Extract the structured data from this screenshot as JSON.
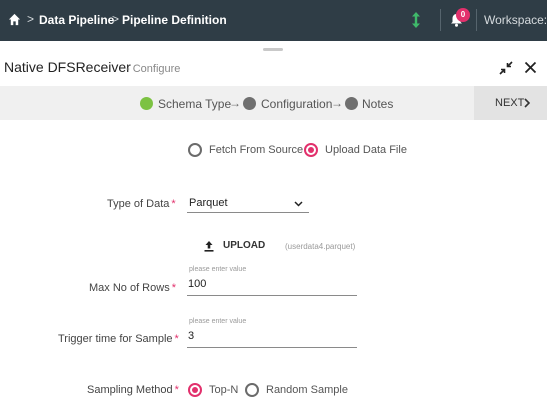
{
  "topbar": {
    "breadcrumbs": [
      "Data Pipeline",
      "Pipeline Definition"
    ],
    "separator": ">",
    "notification_count": "0",
    "workspace_label": "Workspace:"
  },
  "header": {
    "title": "Native DFSReceiver",
    "subtitle": "- Configure"
  },
  "stepper": {
    "steps": [
      {
        "label": "Schema Type",
        "state": "complete",
        "color": "#7cc242"
      },
      {
        "label": "Configuration",
        "state": "pending",
        "color": "#6f6f6f"
      },
      {
        "label": "Notes",
        "state": "pending",
        "color": "#6f6f6f"
      }
    ],
    "arrow": "→",
    "next_label": "NEXT"
  },
  "source": {
    "options": [
      "Fetch From Source",
      "Upload Data File"
    ],
    "selected": "Upload Data File"
  },
  "form": {
    "type_of_data": {
      "label": "Type of Data",
      "required_mark": "*",
      "value": "Parquet"
    },
    "upload": {
      "label": "UPLOAD",
      "file_name": "(userdata4.parquet)"
    },
    "max_rows": {
      "label": "Max No of Rows",
      "required_mark": "*",
      "placeholder": "please enter value",
      "value": "100"
    },
    "trigger_time": {
      "label": "Trigger time for Sample",
      "required_mark": "*",
      "placeholder": "please enter value",
      "value": "3"
    },
    "sampling_method": {
      "label": "Sampling Method",
      "required_mark": "*",
      "options": [
        "Top-N",
        "Random Sample"
      ],
      "selected": "Top-N"
    }
  },
  "colors": {
    "topbar": "#2f3d46",
    "accent": "#e2306c",
    "sync_icon": "#3fb96a",
    "step_complete": "#7cc242"
  },
  "icons": [
    "home-icon",
    "sync-icon",
    "bell-icon",
    "minimize-icon",
    "close-icon",
    "chevron-right-icon",
    "chevron-down-icon",
    "upload-icon"
  ]
}
